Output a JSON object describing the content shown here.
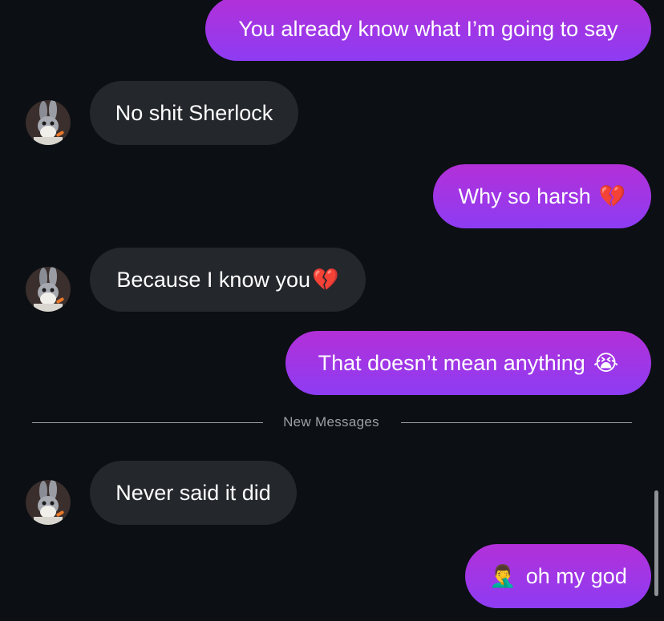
{
  "messages": [
    {
      "text": "You already know what I’m going to say",
      "emoji": ""
    },
    {
      "text": "No shit Sherlock",
      "emoji": ""
    },
    {
      "text": "Why so harsh",
      "emoji": "💔"
    },
    {
      "text": "Because I know you",
      "emoji": "💔"
    },
    {
      "text": "That doesn’t mean anything",
      "emoji": "😭"
    },
    {
      "text": "Never said it did",
      "emoji": ""
    },
    {
      "text": "oh my god",
      "emoji": "🤦‍♂️"
    }
  ],
  "divider": {
    "label": "New Messages"
  },
  "avatar": {
    "icon": "bugs-bunny-avatar-icon"
  },
  "colors": {
    "outgoing_top": "#b330d8",
    "outgoing_bottom": "#8d3cf3",
    "incoming": "#24272c",
    "background": "#0c0f14"
  }
}
